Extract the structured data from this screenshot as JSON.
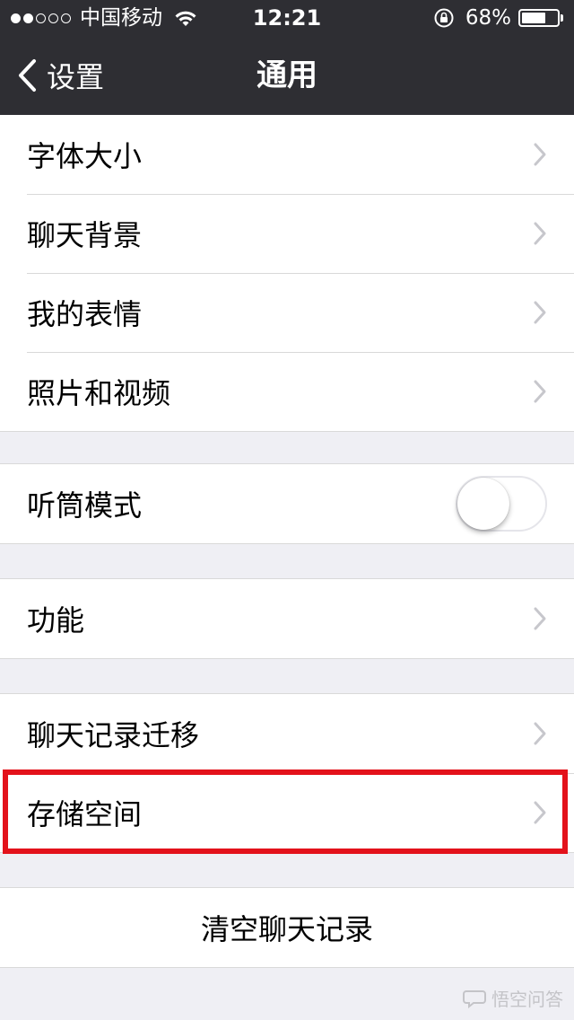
{
  "status_bar": {
    "carrier": "中国移动",
    "time": "12:21",
    "battery_percent": "68%",
    "battery_level": 0.68,
    "signal_bars": 2
  },
  "nav": {
    "back_label": "设置",
    "title": "通用"
  },
  "groups": {
    "display": {
      "font_size": "字体大小",
      "chat_background": "聊天背景",
      "my_stickers": "我的表情",
      "photos_videos": "照片和视频"
    },
    "earpiece": {
      "label": "听筒模式",
      "enabled": false
    },
    "features": {
      "label": "功能"
    },
    "storage": {
      "chat_migration": "聊天记录迁移",
      "storage_space": "存储空间"
    },
    "clear": {
      "label": "清空聊天记录"
    }
  },
  "watermark": "悟空问答",
  "colors": {
    "nav_bg": "#2e2e33",
    "page_bg": "#efeff4",
    "highlight": "#e3121b"
  }
}
